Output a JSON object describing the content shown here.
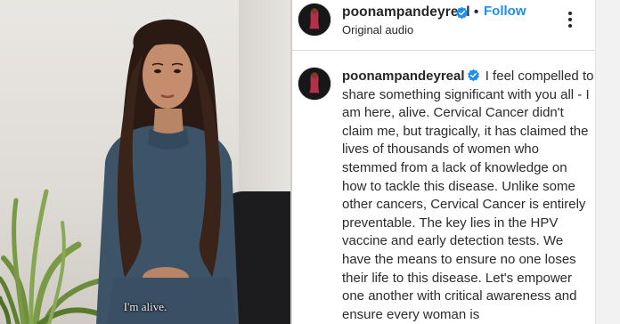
{
  "video": {
    "subtitle": "I'm alive."
  },
  "post": {
    "header": {
      "username": "poonampandeyreal",
      "separator": "•",
      "follow_label": "Follow",
      "audio_label": "Original audio"
    },
    "caption": {
      "username": "poonampandeyreal",
      "text": "I feel compelled to share something significant with you all - I am here, alive. Cervical Cancer didn't claim me, but tragically, it has claimed the lives of thousands of women who stemmed from a lack of knowledge on how to tackle this disease. Unlike some other cancers, Cervical Cancer is entirely preventable. The key lies in the HPV vaccine and early detection tests. We have the means to ensure no one loses their life to this disease. Let's empower one another with critical awareness and ensure every woman is"
    }
  },
  "icons": {
    "verified": "verified-badge-icon",
    "more": "more-options-icon"
  },
  "colors": {
    "follow": "#1d8ff0",
    "verified": "#1d8ff0",
    "text": "#262626"
  }
}
